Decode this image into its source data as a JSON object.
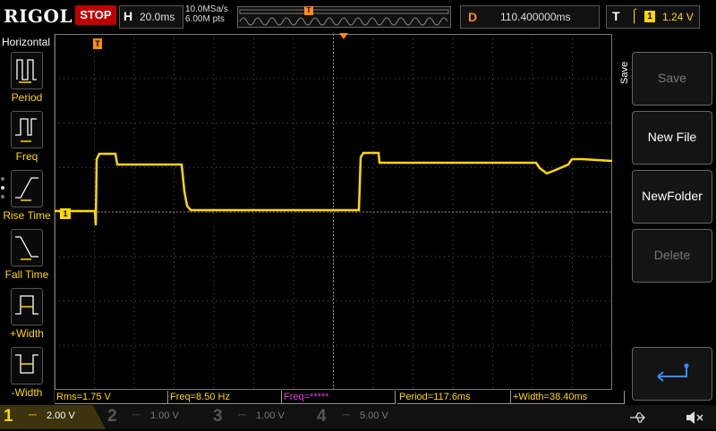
{
  "topbar": {
    "brand": "RIGOL",
    "run_state": "STOP",
    "timebase_label": "H",
    "timebase_value": "20.0ms",
    "sample_rate": "10.0MSa/s",
    "mem_depth": "6.00M pts",
    "trigger_marker": "T",
    "delay_label": "D",
    "delay_value": "110.400000ms",
    "trigger_label": "T",
    "trigger_edge": "rising-edge-icon",
    "trigger_source": "1",
    "trigger_level": "1.24 V"
  },
  "left_menu": {
    "title": "Horizontal",
    "items": [
      {
        "label": "Period",
        "icon": "period-icon"
      },
      {
        "label": "Freq",
        "icon": "freq-icon"
      },
      {
        "label": "Rise Time",
        "icon": "rise-time-icon"
      },
      {
        "label": "Fall Time",
        "icon": "fall-time-icon"
      },
      {
        "label": "+Width",
        "icon": "positive-width-icon"
      },
      {
        "label": "-Width",
        "icon": "negative-width-icon"
      }
    ]
  },
  "right_menu": {
    "title": "Save",
    "buttons": [
      {
        "label": "Save",
        "enabled": false
      },
      {
        "label": "New File",
        "enabled": true
      },
      {
        "label": "NewFolder",
        "enabled": true
      },
      {
        "label": "Delete",
        "enabled": false
      }
    ],
    "return_icon": "return-arrow-icon"
  },
  "markers": {
    "trigger_pos": "T",
    "trigger_level": "T",
    "channel1": "1"
  },
  "measurements": [
    {
      "text": "Rms=1.75 V",
      "color": "#ffd800"
    },
    {
      "text": "Freq=8.50 Hz",
      "color": "#ffd800"
    },
    {
      "text": "Freq=*****",
      "color": "#e040e0"
    },
    {
      "text": "Period=117.6ms",
      "color": "#ffd800"
    },
    {
      "text": "+Width=38.40ms",
      "color": "#ffd800"
    }
  ],
  "channels": [
    {
      "num": "1",
      "scale": "2.00 V",
      "color": "#ffd800",
      "active": true
    },
    {
      "num": "2",
      "scale": "1.00 V",
      "color": "#00c8c8",
      "active": false
    },
    {
      "num": "3",
      "scale": "1.00 V",
      "color": "#e040e0",
      "active": false
    },
    {
      "num": "4",
      "scale": "5.00 V",
      "color": "#3c8cff",
      "active": false
    }
  ],
  "status_icons": [
    "usb-icon",
    "speaker-muted-icon"
  ],
  "colors": {
    "ch1": "#ffd800",
    "trigger": "#ff8c1a",
    "stop": "#c00000"
  }
}
